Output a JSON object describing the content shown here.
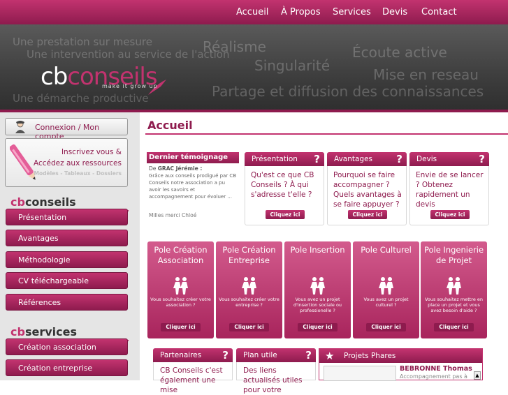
{
  "nav": {
    "items": [
      "Accueil",
      "À Propos",
      "Services",
      "Devis",
      "Contact"
    ]
  },
  "banner": {
    "taglines": [
      "Une prestation sur mesure",
      "Une intervention au service de l'action",
      "Une démarche productive"
    ],
    "keywords": [
      "Réalisme",
      "Écoute active",
      "Singularité",
      "Mise en reseau",
      "Partage et diffusion des connaissances"
    ],
    "logo_cb": "cb",
    "logo_conseils": "conseils",
    "slogan": "make it grow up"
  },
  "sidebar": {
    "login_label": "Connexion / Mon compte",
    "register_line1": "Inscrivez vous &",
    "register_line2": "Accédez aux ressources",
    "register_line3": "Modèles - Tableaux - Dossiers",
    "section1_cb": "cb",
    "section1_name": "conseils",
    "section1_items": [
      "Présentation",
      "Avantages",
      "Méthodologie",
      "CV téléchargeable",
      "Références"
    ],
    "section2_cb": "cb",
    "section2_name": "services",
    "section2_items": [
      "Création association",
      "Création entreprise"
    ]
  },
  "main": {
    "title": "Accueil",
    "testimonial": {
      "heading": "Dernier témoignage",
      "from_prefix": "De",
      "author": "GRAC Jérémie :",
      "text": "Grâce aux conseils prodigué par CB Conseils notre association a pu avoir les savoirs et accompagnement pour évoluer ...",
      "signature": "Milles merci Chloé"
    },
    "cards": [
      {
        "title": "Présentation",
        "body": "Qu'est ce que CB Conseils ? À qui s'adresse t'elle ?",
        "cta": "Cliquez ici"
      },
      {
        "title": "Avantages",
        "body": "Pourquoi se faire accompagner ? Quels avantages à se faire appuyer ?",
        "cta": "Cliquez ici"
      },
      {
        "title": "Devis",
        "body": "Envie de se lancer ? Obtenez rapidement un devis",
        "cta": "Cliquez ici"
      }
    ],
    "poles": [
      {
        "title": "Pole Création Association",
        "desc": "Vous souhaitez créer votre association ?",
        "cta": "Cliquer ici"
      },
      {
        "title": "Pole Création Entreprise",
        "desc": "Vous souhaitez créer votre entreprise ?",
        "cta": "Cliquer ici"
      },
      {
        "title": "Pole Insertion",
        "desc": "Vous avez un projet d'insertion sociale ou professionelle ?",
        "cta": "Cliquer ici"
      },
      {
        "title": "Pole Culturel",
        "desc": "Vous avez un projet culturel ?",
        "cta": "Cliquer ici"
      },
      {
        "title": "Pole Ingenierie de Projet",
        "desc": "Vous souhaitez mettre en place un projet et vous avez besoin d'aide ?",
        "cta": "Cliquer ici"
      }
    ],
    "bottom": {
      "partners_title": "Partenaires",
      "partners_body": "CB Conseils c'est également une mise",
      "plan_title": "Plan utile",
      "plan_body": "Des liens actualisés utiles pour votre",
      "projects_title": "Projets Phares",
      "project_name": "BEBRONNE Thomas",
      "project_sub": "Accompagnement pas à"
    }
  },
  "colors": {
    "accent": "#c2336f",
    "accent_dark": "#8e1b4e",
    "banner_bg": "#4a4a4a"
  }
}
